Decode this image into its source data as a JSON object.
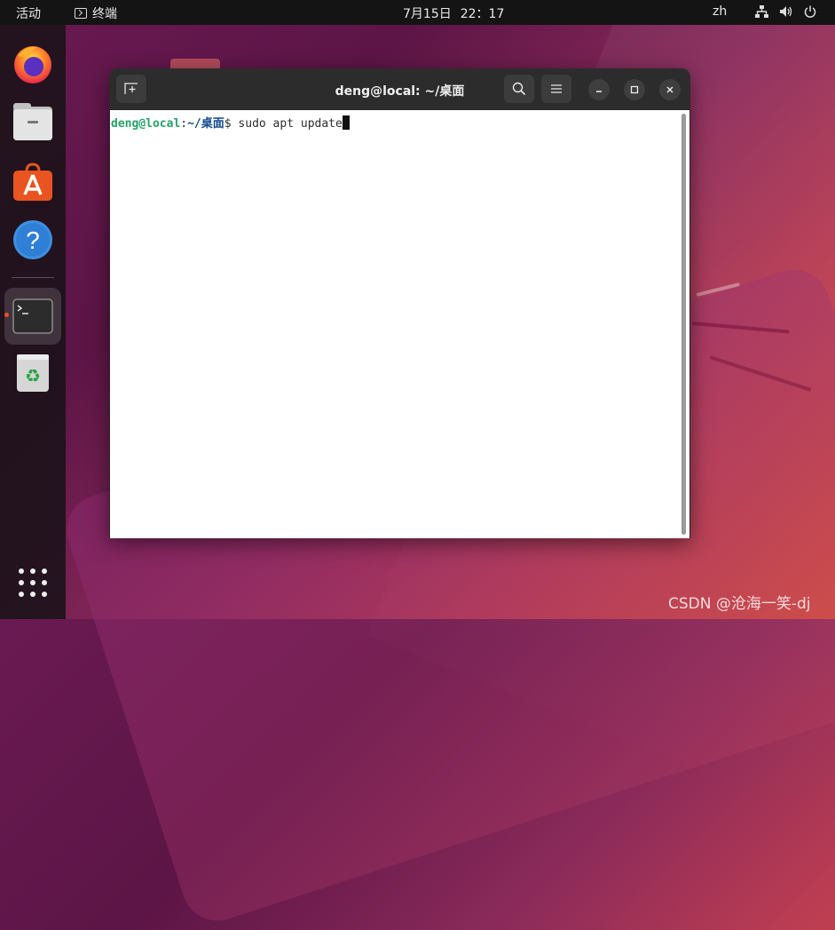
{
  "topbar": {
    "activities": "活动",
    "app_name": "终端",
    "date": "7月15日",
    "time": "22：17",
    "lang": "zh"
  },
  "dock": {
    "items": [
      {
        "name": "firefox"
      },
      {
        "name": "files"
      },
      {
        "name": "software"
      },
      {
        "name": "help"
      },
      {
        "name": "terminal",
        "active": true
      },
      {
        "name": "trash"
      }
    ]
  },
  "terminal": {
    "title": "deng@local: ~/桌面",
    "prompt_user": "deng@local",
    "prompt_colon": ":",
    "prompt_path": "~/桌面",
    "prompt_symbol": "$ ",
    "command": "sudo apt update"
  },
  "watermark": "CSDN @沧海一笑-dj",
  "colors": {
    "accent": "#e95420",
    "prompt_user": "#26a269",
    "prompt_path": "#12488b"
  }
}
